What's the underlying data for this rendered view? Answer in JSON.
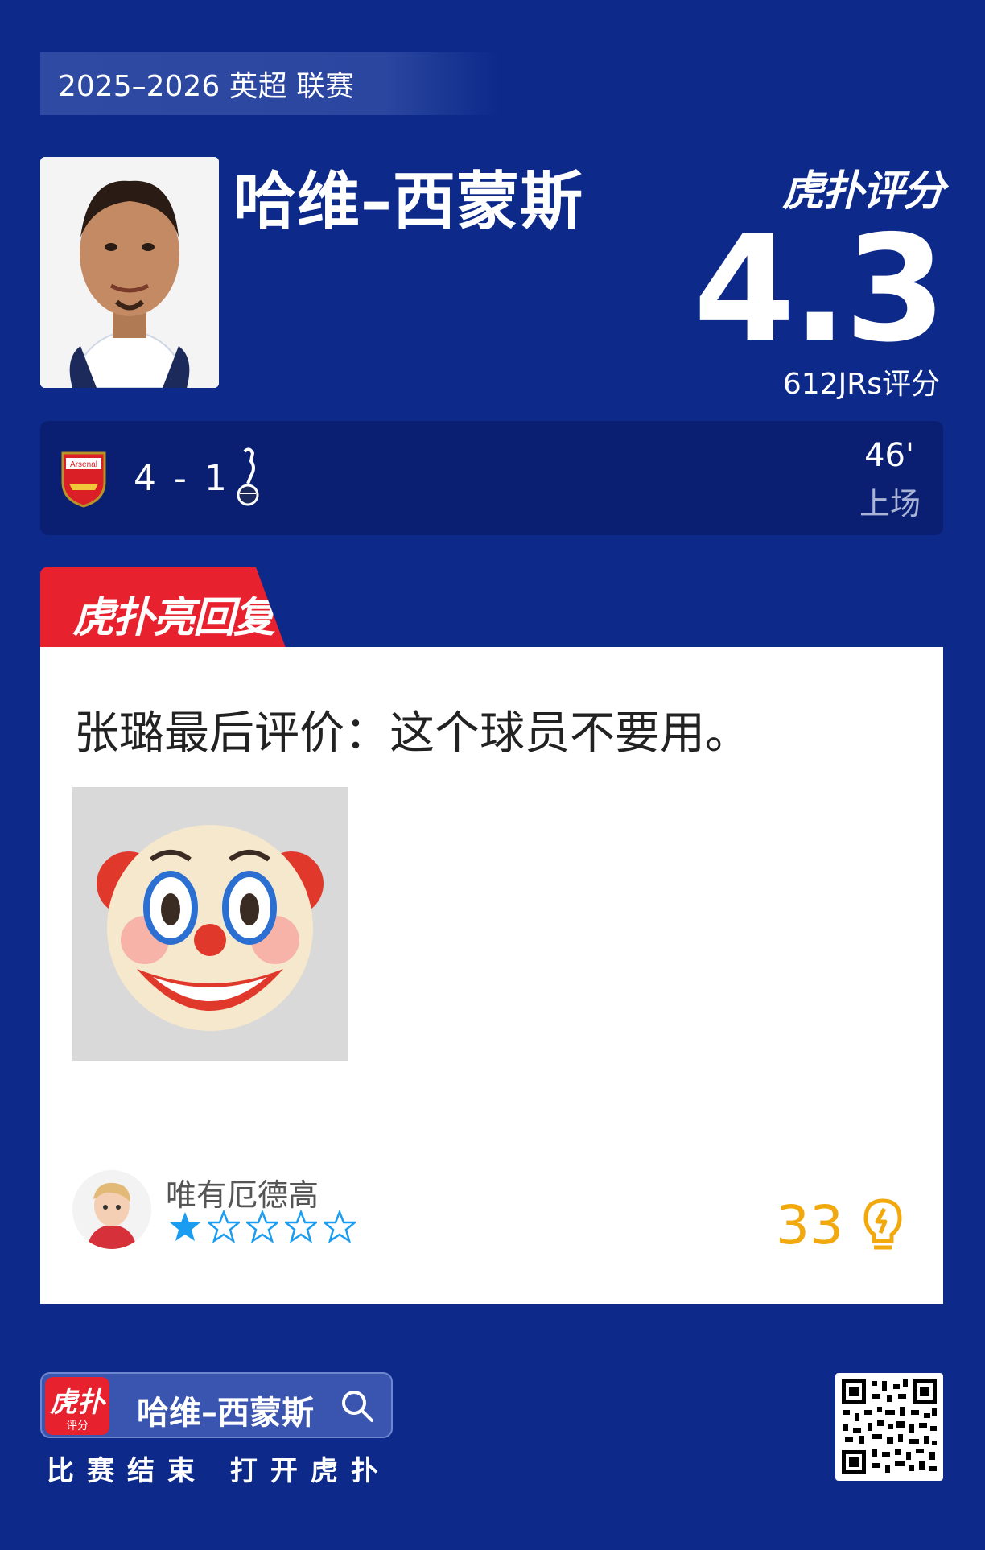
{
  "header": {
    "season": "2025–2026 英超 联赛"
  },
  "player": {
    "name": "哈维–西蒙斯",
    "brand": "虎扑评分",
    "score": "4.3",
    "count": "612JRs评分"
  },
  "match": {
    "score": "4 - 1",
    "minute": "46'",
    "minute_label": "上场",
    "home_club_text": "Arsenal"
  },
  "highlight": {
    "tab_label": "虎扑亮回复",
    "quote": "张璐最后评价：这个球员不要用。",
    "emoji": "clown-face",
    "user": {
      "name": "唯有厄德高",
      "stars_filled": 1,
      "stars_total": 5
    },
    "likes": "33"
  },
  "footer": {
    "app_icon_top": "虎扑",
    "app_icon_bottom": "评分",
    "search_name": "哈维–西蒙斯",
    "caption": "比赛结束 打开虎扑"
  },
  "colors": {
    "background": "#0d2a8a",
    "accent_red": "#e8212e",
    "likes_gold": "#f2a90d",
    "star_blue": "#1a9cf0"
  }
}
